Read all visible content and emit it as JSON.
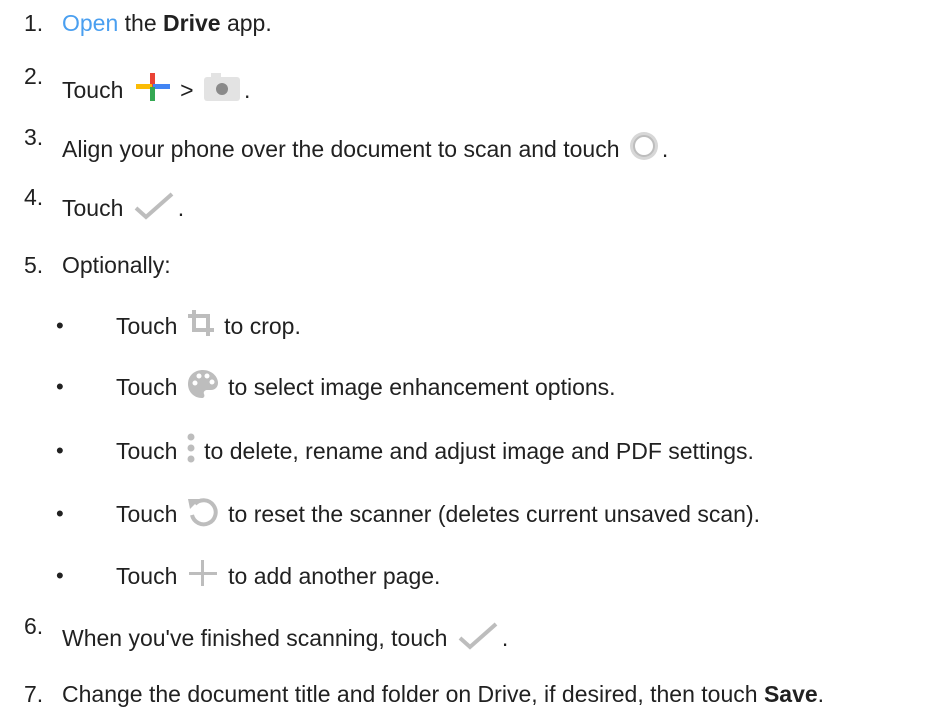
{
  "steps": [
    {
      "number": "1.",
      "pre": "Open",
      "mid": " the ",
      "bold": "Drive",
      "post": " app."
    },
    {
      "number": "2.",
      "pre": "Touch ",
      "sep": " > ",
      "post": "."
    },
    {
      "number": "3.",
      "pre": "Align your phone over the document to scan and touch ",
      "post": "."
    },
    {
      "number": "4.",
      "pre": "Touch ",
      "post": "."
    },
    {
      "number": "5.",
      "pre": "Optionally:"
    },
    {
      "number": "6.",
      "pre": "When you've finished scanning, touch ",
      "post": "."
    },
    {
      "number": "7.",
      "pre": "Change the document title and folder on Drive, if desired, then touch ",
      "bold": "Save",
      "post": "."
    }
  ],
  "substeps": [
    {
      "bullet": "•",
      "pre": "Touch ",
      "post": " to crop."
    },
    {
      "bullet": "•",
      "pre": "Touch ",
      "post": " to select image enhancement options."
    },
    {
      "bullet": "•",
      "pre": "Touch ",
      "post": " to delete, rename and adjust image and PDF settings."
    },
    {
      "bullet": "•",
      "pre": "Touch ",
      "post": " to reset the scanner (deletes current unsaved scan)."
    },
    {
      "bullet": "•",
      "pre": "Touch ",
      "post": " to add another page."
    }
  ],
  "icons": {
    "plus_color": "google-plus-icon",
    "camera": "camera-icon",
    "shutter": "shutter-button-icon",
    "check": "checkmark-icon",
    "crop": "crop-icon",
    "palette": "palette-icon",
    "more": "more-vert-icon",
    "reset": "reset-icon",
    "add": "add-page-icon"
  },
  "colors": {
    "link": "#4a9ff0",
    "text": "#212121",
    "icon_gray": "#bdbdbd"
  }
}
